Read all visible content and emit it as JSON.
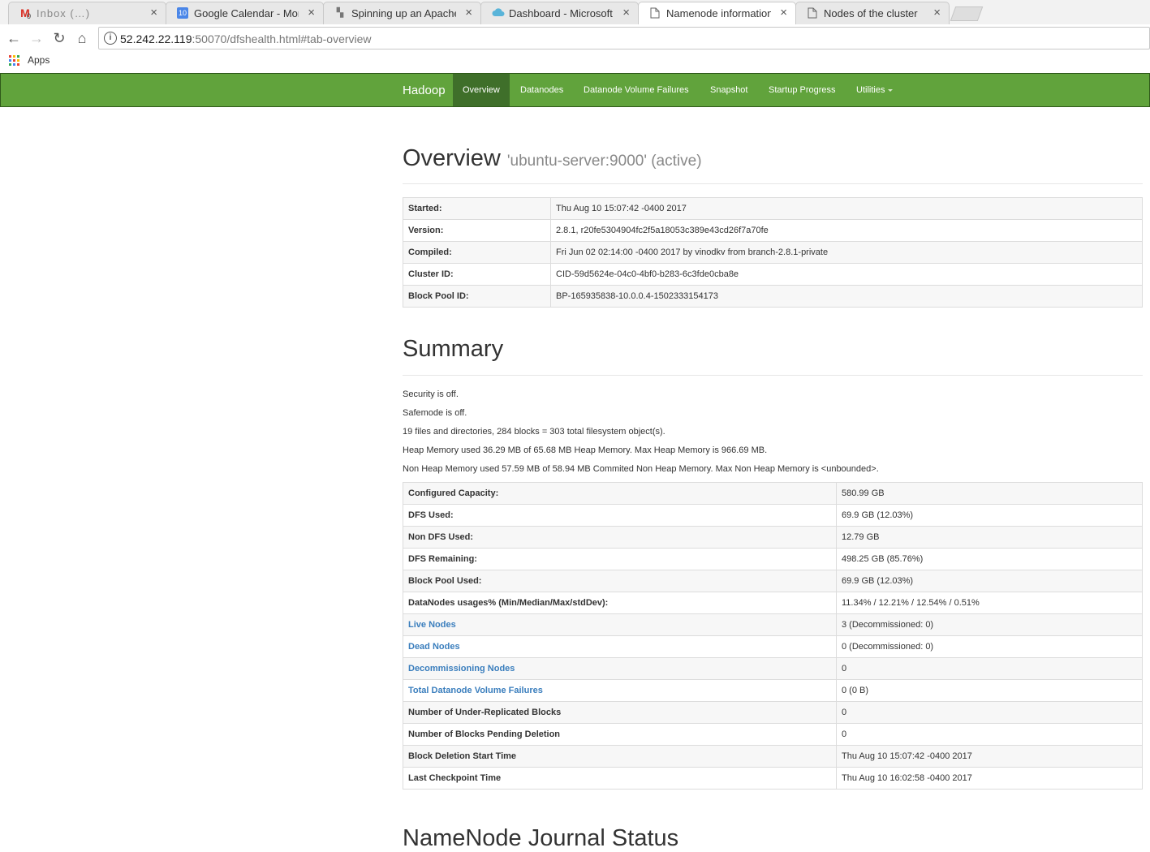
{
  "browser": {
    "tabs": [
      {
        "title": "Inbox (…)",
        "favicon": "gmail-icon"
      },
      {
        "title": "Google Calendar - Month",
        "favicon": "calendar-icon"
      },
      {
        "title": "Spinning up an Apache S",
        "favicon": "page-icon"
      },
      {
        "title": "Dashboard - Microsoft A",
        "favicon": "cloud-icon"
      },
      {
        "title": "Namenode information",
        "favicon": "document-icon"
      },
      {
        "title": "Nodes of the cluster",
        "favicon": "document-icon"
      }
    ],
    "calendar_badge": "10",
    "gmail_badge": "0",
    "url_host": "52.242.22.119",
    "url_rest": ":50070/dfshealth.html#tab-overview",
    "bookmarks_apps": "Apps"
  },
  "navbar": {
    "brand": "Hadoop",
    "items": [
      "Overview",
      "Datanodes",
      "Datanode Volume Failures",
      "Snapshot",
      "Startup Progress",
      "Utilities"
    ]
  },
  "overview": {
    "title": "Overview",
    "subtitle": "'ubuntu-server:9000' (active)",
    "rows": [
      {
        "label": "Started:",
        "value": "Thu Aug 10 15:07:42 -0400 2017"
      },
      {
        "label": "Version:",
        "value": "2.8.1, r20fe5304904fc2f5a18053c389e43cd26f7a70fe"
      },
      {
        "label": "Compiled:",
        "value": "Fri Jun 02 02:14:00 -0400 2017 by vinodkv from branch-2.8.1-private"
      },
      {
        "label": "Cluster ID:",
        "value": "CID-59d5624e-04c0-4bf0-b283-6c3fde0cba8e"
      },
      {
        "label": "Block Pool ID:",
        "value": "BP-165935838-10.0.0.4-1502333154173"
      }
    ]
  },
  "summary": {
    "title": "Summary",
    "lines": [
      "Security is off.",
      "Safemode is off.",
      "19 files and directories, 284 blocks = 303 total filesystem object(s).",
      "Heap Memory used 36.29 MB of 65.68 MB Heap Memory. Max Heap Memory is 966.69 MB.",
      "Non Heap Memory used 57.59 MB of 58.94 MB Commited Non Heap Memory. Max Non Heap Memory is <unbounded>."
    ],
    "rows": [
      {
        "label": "Configured Capacity:",
        "value": "580.99 GB"
      },
      {
        "label": "DFS Used:",
        "value": "69.9 GB (12.03%)"
      },
      {
        "label": "Non DFS Used:",
        "value": "12.79 GB"
      },
      {
        "label": "DFS Remaining:",
        "value": "498.25 GB (85.76%)"
      },
      {
        "label": "Block Pool Used:",
        "value": "69.9 GB (12.03%)"
      },
      {
        "label": "DataNodes usages% (Min/Median/Max/stdDev):",
        "value": "11.34% / 12.21% / 12.54% / 0.51%"
      },
      {
        "label": "Live Nodes",
        "value": "3 (Decommissioned: 0)"
      },
      {
        "label": "Dead Nodes",
        "value": "0 (Decommissioned: 0)"
      },
      {
        "label": "Decommissioning Nodes",
        "value": "0"
      },
      {
        "label": "Total Datanode Volume Failures",
        "value": "0 (0 B)"
      },
      {
        "label": "Number of Under-Replicated Blocks",
        "value": "0"
      },
      {
        "label": "Number of Blocks Pending Deletion",
        "value": "0"
      },
      {
        "label": "Block Deletion Start Time",
        "value": "Thu Aug 10 15:07:42 -0400 2017"
      },
      {
        "label": "Last Checkpoint Time",
        "value": "Thu Aug 10 16:02:58 -0400 2017"
      }
    ]
  },
  "journal": {
    "title": "NameNode Journal Status"
  }
}
